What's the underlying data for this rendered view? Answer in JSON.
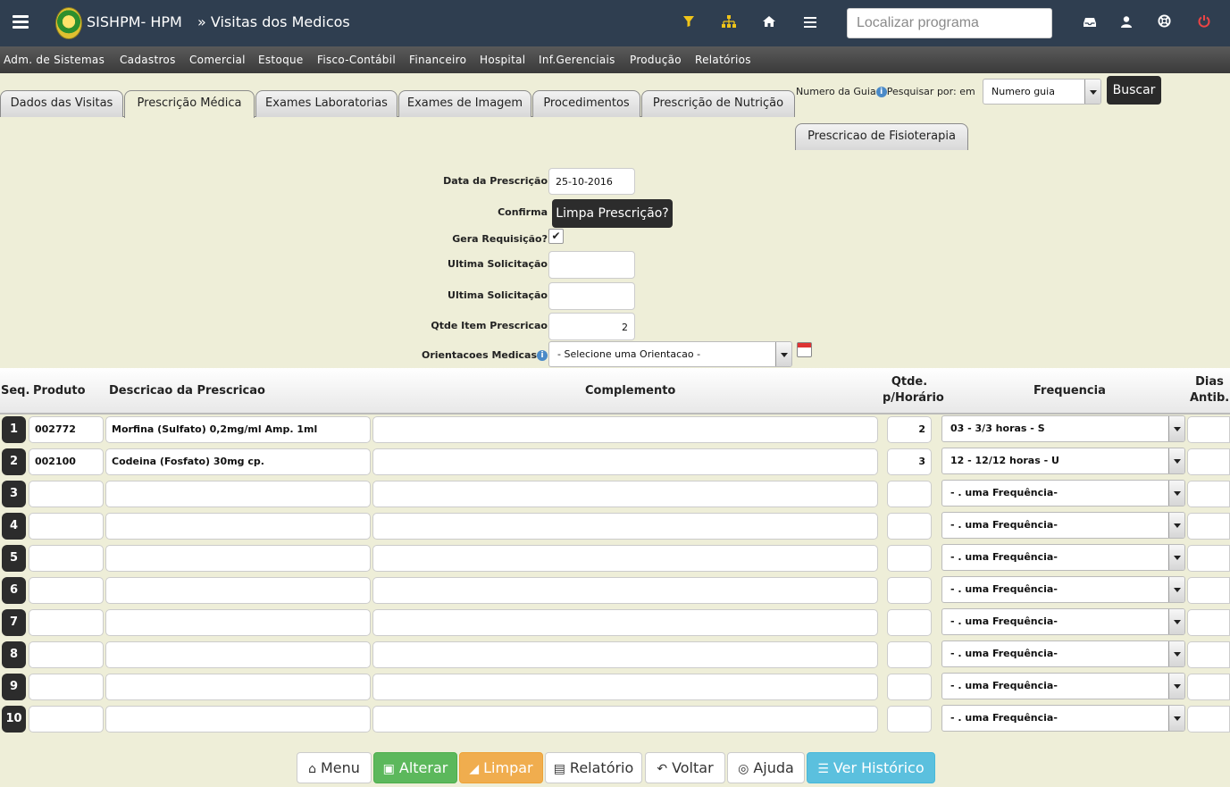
{
  "header": {
    "brand": "SISHPM- HPM",
    "page_heading": "» Visitas dos Medicos",
    "search_placeholder": "Localizar programa"
  },
  "menubar": [
    "Adm. de Sistemas",
    "Cadastros",
    "Comercial",
    "Estoque",
    "Fisco-Contábil",
    "Financeiro",
    "Hospital",
    "Inf.Gerenciais",
    "Produção",
    "Relatórios"
  ],
  "tabs": [
    "Dados das Visitas",
    "Prescrição Médica",
    "Exames Laboratorias",
    "Exames de Imagem",
    "Procedimentos",
    "Prescrição de Nutrição",
    "Prescricao de Fisioterapia"
  ],
  "search_panel": {
    "numero_label": "Numero da Guia",
    "pesquisar_label": "Pesquisar por: em",
    "select_value": "Numero guia",
    "button": "Buscar"
  },
  "form": {
    "data_label": "Data da Prescrição",
    "data_value": "25-10-2016",
    "confirma_label": "Confirma",
    "tooltip": "Limpa Prescrição?",
    "gera_label": "Gera Requisição?",
    "gera_checked": "✔",
    "ultima1_label": "Ultima Solicitação",
    "ultima2_label": "Ultima Solicitação",
    "qtde_label": "Qtde Item Prescricao",
    "qtde_value": "2",
    "orient_label": "Orientacoes Medicas",
    "orient_value": "- Selecione uma Orientacao -"
  },
  "table": {
    "headers": {
      "seq": "Seq.",
      "produto": "Produto",
      "descricao": "Descricao da Prescricao",
      "complemento": "Complemento",
      "qtde1": "Qtde.",
      "qtde2": "p/Horário",
      "frequencia": "Frequencia",
      "dias1": "Dias",
      "dias2": "Antib."
    },
    "rows": [
      {
        "seq": "1",
        "produto": "002772",
        "descricao": "Morfina (Sulfato) 0,2mg/ml Amp. 1ml",
        "qtde": "2",
        "freq": "03 - 3/3 horas - S"
      },
      {
        "seq": "2",
        "produto": "002100",
        "descricao": "Codeina (Fosfato) 30mg cp.",
        "qtde": "3",
        "freq": "12 - 12/12 horas - U"
      },
      {
        "seq": "3",
        "produto": "",
        "descricao": "",
        "qtde": "",
        "freq": "- . uma Frequência-"
      },
      {
        "seq": "4",
        "produto": "",
        "descricao": "",
        "qtde": "",
        "freq": "- . uma Frequência-"
      },
      {
        "seq": "5",
        "produto": "",
        "descricao": "",
        "qtde": "",
        "freq": "- . uma Frequência-"
      },
      {
        "seq": "6",
        "produto": "",
        "descricao": "",
        "qtde": "",
        "freq": "- . uma Frequência-"
      },
      {
        "seq": "7",
        "produto": "",
        "descricao": "",
        "qtde": "",
        "freq": "- . uma Frequência-"
      },
      {
        "seq": "8",
        "produto": "",
        "descricao": "",
        "qtde": "",
        "freq": "- . uma Frequência-"
      },
      {
        "seq": "9",
        "produto": "",
        "descricao": "",
        "qtde": "",
        "freq": "- . uma Frequência-"
      },
      {
        "seq": "10",
        "produto": "",
        "descricao": "",
        "qtde": "",
        "freq": "- . uma Frequência-"
      }
    ]
  },
  "footer": {
    "menu": "Menu",
    "alterar": "Alterar",
    "limpar": "Limpar",
    "relatorio": "Relatório",
    "voltar": "Voltar",
    "ajuda": "Ajuda",
    "historico": "Ver Histórico"
  },
  "colors": {
    "topbar": "#2f3e50",
    "background": "#eeeed8",
    "green": "#5cb85c",
    "orange": "#f0ad4e",
    "blue": "#5bc0de"
  },
  "icons": [
    "menu-icon",
    "filter-icon",
    "sitemap-icon",
    "home-icon",
    "list-icon",
    "inbox-icon",
    "user-icon",
    "lifebuoy-icon",
    "power-icon",
    "info-icon",
    "calendar-icon"
  ]
}
